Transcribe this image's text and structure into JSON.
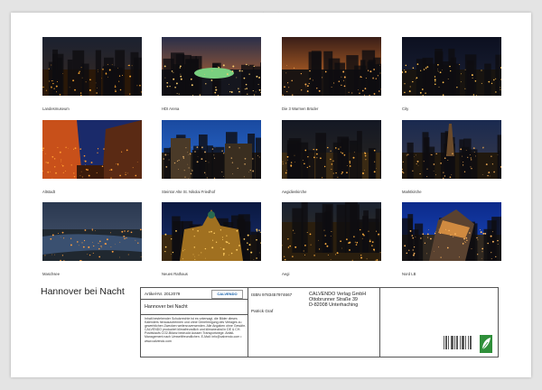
{
  "calendar": {
    "title": "Hannover bei Nacht",
    "photos": [
      {
        "caption": "Landesmuseum",
        "scene": "cityscape-dusk"
      },
      {
        "caption": "HDI Arena",
        "scene": "stadium-sunset"
      },
      {
        "caption": "Die 3 Warmen Brüder",
        "scene": "sunset-city"
      },
      {
        "caption": "City",
        "scene": "city-night"
      },
      {
        "caption": "Altstadt",
        "scene": "oldtown-street"
      },
      {
        "caption": "Steintor Alte St. Nikolai Friedhof",
        "scene": "ruin-blue"
      },
      {
        "caption": "Aegidienkirche",
        "scene": "rooftops-night"
      },
      {
        "caption": "Marktkirche",
        "scene": "church-skyline"
      },
      {
        "caption": "Maschsee",
        "scene": "lake-dusk"
      },
      {
        "caption": "Neues Rathaus",
        "scene": "townhall-gold"
      },
      {
        "caption": "Aegi",
        "scene": "aerial-lights"
      },
      {
        "caption": "Nord LB",
        "scene": "modern-building"
      }
    ]
  },
  "info": {
    "article_label": "Artikel-Nr. 2012079",
    "publisher_logo": "CALVENDO",
    "calendar_title": "Hannover bei Nacht",
    "isbn": "ISBN 9783457974667",
    "author": "Patrick Graf",
    "publisher_lines": [
      "CALVENDO Verlag GmbH",
      "Ottobrunner Straße 39",
      "D-82008 Unterhaching"
    ],
    "blurb": "Inhalt bestehender Schutzrechte ist es untersagt, die Bilder dieses Kalenders herauszutrennen und ohne Genehmigung des Verlages zu gewerblichen Zwecken weiterzuverwenden. Alle Angaben ohne Gewähr. CALVENDO produziert klimafreundlich und klimaneutral in DE & CH. Positivlaufs CO2-Bilanz bedruckt Aussen Transportwege. Abfall-Management nach Umweltfreundlichen. E-Mail: info@calvendo.com • www.calvendo.com"
  }
}
